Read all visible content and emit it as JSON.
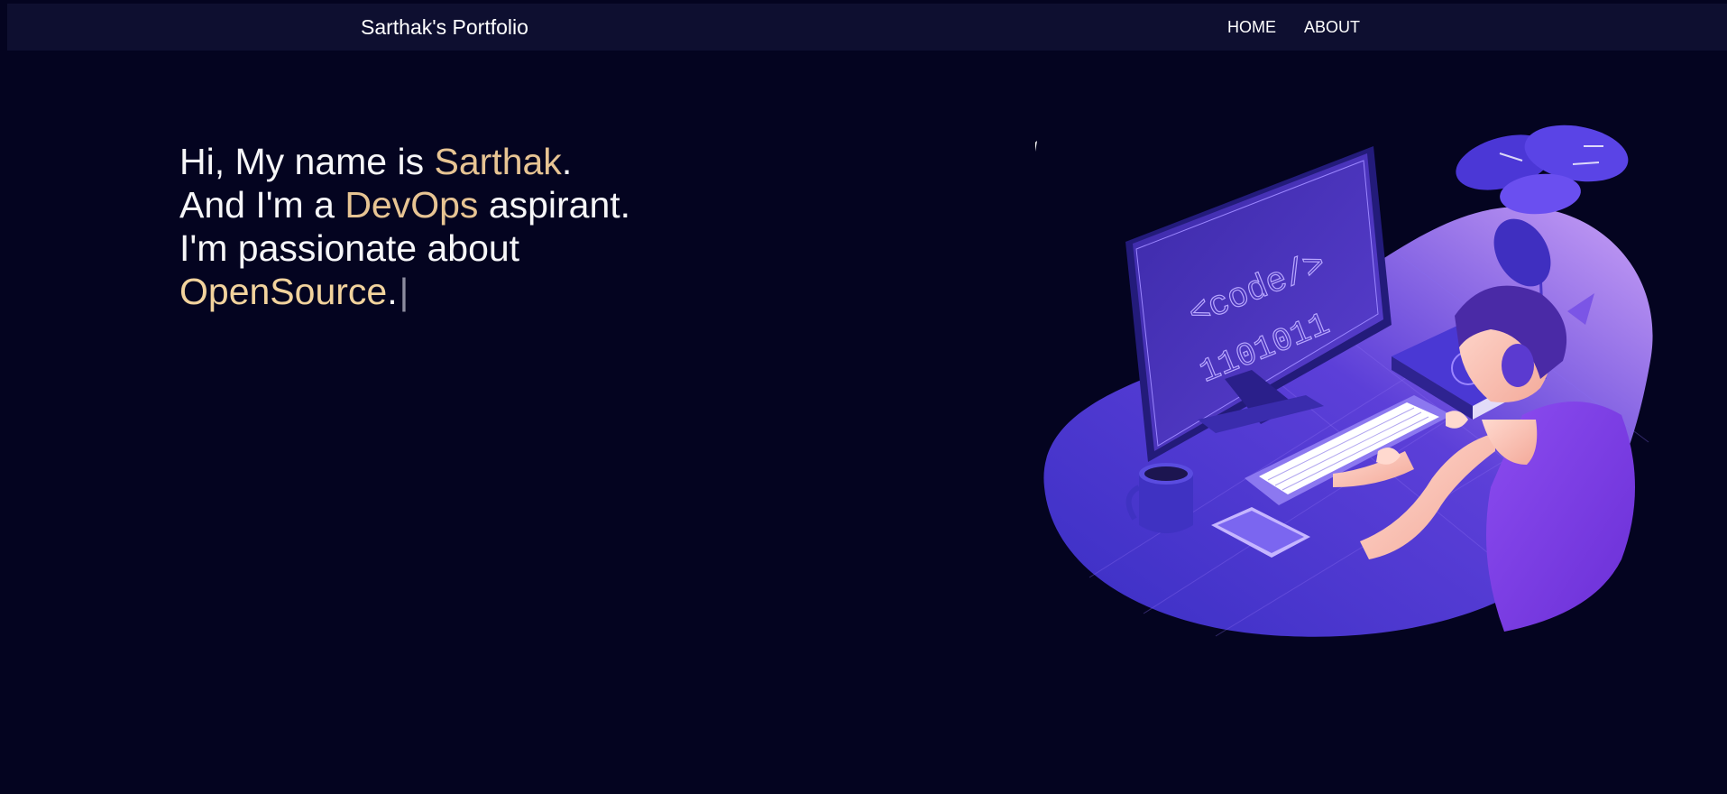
{
  "navbar": {
    "brand": "Sarthak's Portfolio",
    "links": [
      "HOME",
      "ABOUT"
    ]
  },
  "intro": {
    "line1_pre": "Hi, My name is ",
    "line1_name": "Sarthak",
    "line1_post": ".",
    "line2_pre": "And I'm a ",
    "line2_role": "DevOps",
    "line2_post": " aspirant.",
    "line3": "I'm passionate about",
    "line4_word": "OpenSource",
    "line4_post": ".",
    "cursor": "|"
  },
  "illustration": {
    "screen_code": "<code/>",
    "screen_binary": "1101011"
  },
  "colors": {
    "background": "#040420",
    "navbar": "#0e0f30",
    "highlight": "#e7c493",
    "accent_purple": "#7b4be8"
  }
}
